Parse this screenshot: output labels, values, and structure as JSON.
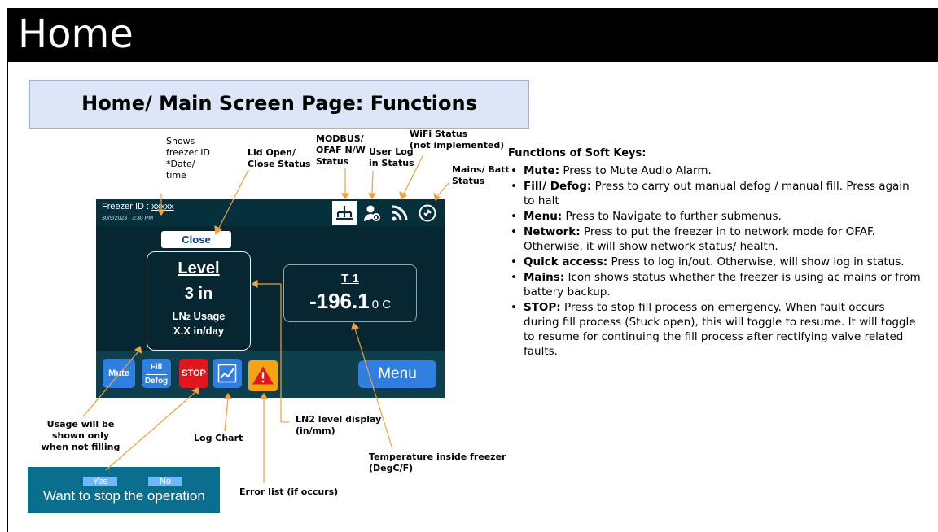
{
  "slide": {
    "title": "Home",
    "subtitle": "Home/ Main Screen Page: Functions"
  },
  "annotations": {
    "freezer_id": [
      "Shows",
      "freezer ID",
      "*Date/",
      "time"
    ],
    "lid": [
      "Lid Open/",
      "Close Status"
    ],
    "modbus": [
      "MODBUS/",
      "OFAF N/W",
      "Status"
    ],
    "user_log": [
      "User Log",
      "in Status"
    ],
    "wifi": [
      "WiFi Status",
      "(not implemented)"
    ],
    "mains": [
      "Mains/ Batt",
      "Status"
    ],
    "usage": [
      "Usage will be",
      "shown only",
      "when not filling"
    ],
    "log_chart": "Log Chart",
    "ln2_level": [
      "LN2 level display",
      "(in/mm)"
    ],
    "error_list": "Error list (if occurs)",
    "temperature": [
      "Temperature inside freezer",
      "(DegC/F)"
    ]
  },
  "screen": {
    "freezer_label": "Freezer ID :",
    "freezer_id": "xxxxx",
    "date": "30/9/2023",
    "time": "3:30 PM",
    "icons": [
      "network-icon",
      "user-log-icon",
      "wifi-icon",
      "mains-battery-icon"
    ],
    "close_label": "Close",
    "level_label": "Level",
    "level_value": "3 in",
    "usage_label_prefix": "LN",
    "usage_label_sub": "2",
    "usage_label_suffix": " Usage",
    "usage_value": "X.X in/day",
    "temp_label": "T 1",
    "temp_value": "-196.1",
    "temp_unit": "0 C",
    "buttons": {
      "mute": "Mute",
      "fill": "Fill",
      "defog": "Defog",
      "stop": "STOP",
      "menu": "Menu"
    }
  },
  "dialog": {
    "yes": "Yes",
    "no": "No",
    "question": "Want to stop the operation"
  },
  "functions": {
    "heading": "Functions of Soft Keys:",
    "items": [
      {
        "key": "Mute:",
        "text": "Press to Mute Audio Alarm."
      },
      {
        "key": "Fill/ Defog:",
        "text": "Press to carry out manual defog / manual fill. Press again to halt"
      },
      {
        "key": "Menu:",
        "text": "Press to Navigate to further submenus."
      },
      {
        "key": "Network:",
        "text": "Press to put the freezer in to network mode for OFAF. Otherwise, it will show network status/ health."
      },
      {
        "key": "Quick access:",
        "text": "Press to log in/out. Otherwise, will show log in status."
      },
      {
        "key": "Mains:",
        "text": "Icon shows status whether the freezer is using ac mains or from battery backup."
      },
      {
        "key": "STOP:",
        "text": "Press to stop fill process on emergency. When fault occurs during fill process (Stuck open), this will toggle to resume. It will toggle to resume for continuing the fill process after rectifying valve related faults."
      }
    ]
  },
  "colors": {
    "header_bg": "#000000",
    "subtitle_bg": "#dde6f6",
    "screen_bg": "#062631",
    "button_blue": "#2f7fe0",
    "stop_red": "#e0161e",
    "warning_orange": "#f6a313",
    "leader_orange": "#f0a040"
  }
}
